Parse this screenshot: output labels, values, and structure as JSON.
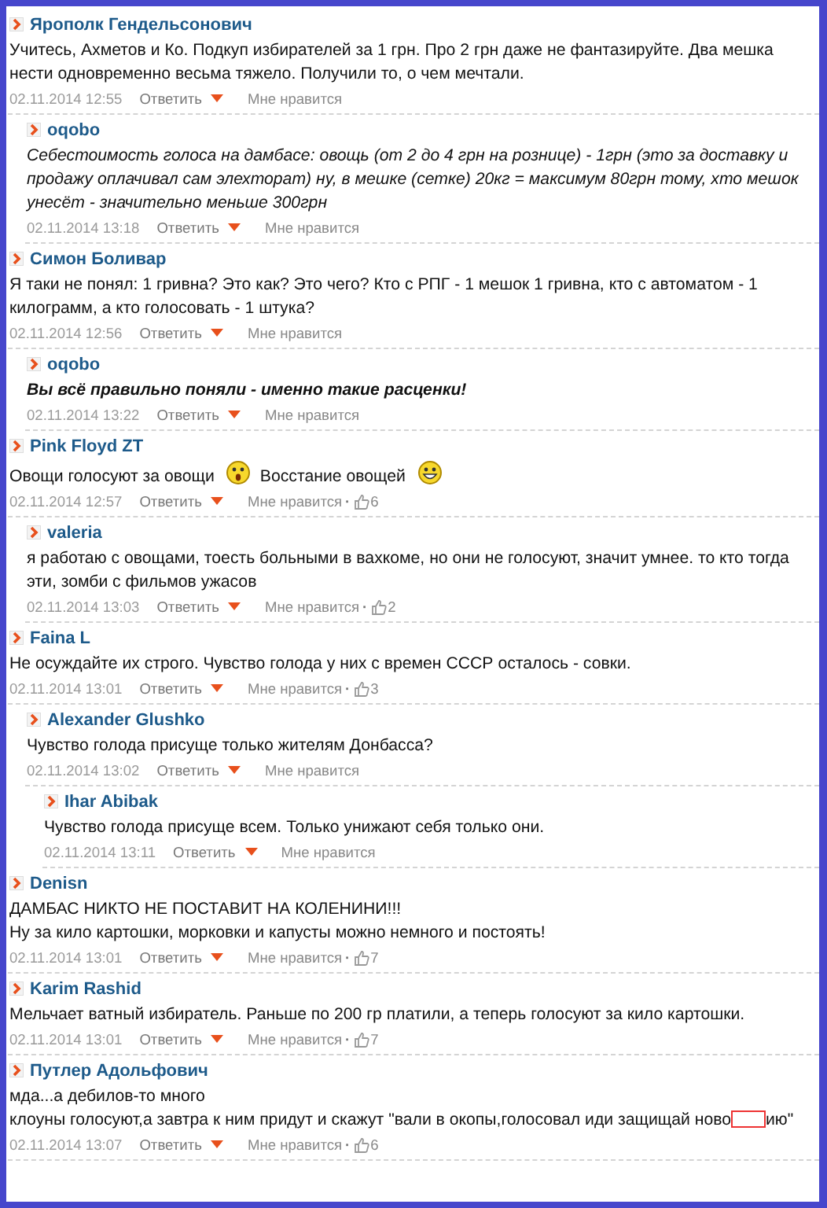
{
  "comments": [
    {
      "author": "Ярополк Гендельсонович",
      "body": [
        {
          "kind": "text",
          "text": "Учитесь, Ахметов и Ко. Подкуп избирателей за 1 грн. Про 2 грн даже не фантазируйте. Два мешка нести одновременно весьма тяжело. Получили то, о чем мечтали."
        }
      ],
      "date": "02.11.2014 12:55",
      "reply": "Ответить",
      "like": "Мне нравится",
      "children": [
        {
          "author": "oqobo",
          "body": [
            {
              "kind": "text",
              "text": "Себестоимость голоса на дамбасе: овощь (от 2 до 4 грн на рознице) - 1грн (это за доставку и продажу оплачивал сам элехторат) ну, в мешке (сетке) 20кг = максимум 80грн тому, хто мешок унесёт - значительно меньше 300грн"
            }
          ],
          "date": "02.11.2014 13:18",
          "reply": "Ответить",
          "like": "Мне нравится"
        }
      ]
    },
    {
      "author": "Симон Боливар",
      "body": [
        {
          "kind": "text",
          "text": "Я таки не понял: 1 гривна? Это как? Это чего? Кто с РПГ - 1 мешок 1 гривна, кто с автоматом - 1 килограмм, а кто голосовать - 1 штука?"
        }
      ],
      "date": "02.11.2014 12:56",
      "reply": "Ответить",
      "like": "Мне нравится",
      "children": [
        {
          "author": "oqobo",
          "body": [
            {
              "kind": "text",
              "text": "Вы всё правильно поняли - именно такие расценки!"
            }
          ],
          "date": "02.11.2014 13:22",
          "reply": "Ответить",
          "like": "Мне нравится"
        }
      ]
    },
    {
      "author": "Pink Floyd ZT",
      "body": [
        {
          "kind": "text",
          "text": "Овощи голосуют за овощи"
        },
        {
          "kind": "surprised-emoji"
        },
        {
          "kind": "text",
          "text": "Восстание овощей"
        },
        {
          "kind": "laughing-emoji"
        }
      ],
      "date": "02.11.2014 12:57",
      "reply": "Ответить",
      "like": "Мне нравится",
      "separator": "·",
      "likes": "6",
      "children": [
        {
          "author": "valeria",
          "body": [
            {
              "kind": "text",
              "text": "я работаю с овощами, тоесть больными в вахкоме, но они не голосуют, значит умнее. то кто тогда эти, зомби с фильмов ужасов"
            }
          ],
          "date": "02.11.2014 13:03",
          "reply": "Ответить",
          "like": "Мне нравится",
          "separator": "·",
          "likes": "2"
        }
      ]
    },
    {
      "author": "Faina L",
      "body": [
        {
          "kind": "text",
          "text": "Не осуждайте их строго. Чувство голода у них с времен СССР осталось - совки."
        }
      ],
      "date": "02.11.2014 13:01",
      "reply": "Ответить",
      "like": "Мне нравится",
      "separator": "·",
      "likes": "3",
      "children": [
        {
          "author": "Alexander Glushko",
          "body": [
            {
              "kind": "text",
              "text": "Чувство голода присуще только жителям Донбасса?"
            }
          ],
          "date": "02.11.2014 13:02",
          "reply": "Ответить",
          "like": "Мне нравится",
          "children": [
            {
              "author": "Ihar Abibak",
              "body": [
                {
                  "kind": "text",
                  "text": "Чувство голода присуще всем. Только унижают себя только они."
                }
              ],
              "date": "02.11.2014 13:11",
              "reply": "Ответить",
              "like": "Мне нравится"
            }
          ]
        }
      ]
    },
    {
      "author": "Denisn",
      "body": [
        {
          "kind": "text",
          "text": "ДАМБАС НИКТО НЕ ПОСТАВИТ НА КОЛЕНИНИ!!!"
        },
        {
          "kind": "break"
        },
        {
          "kind": "text",
          "text": "Ну за кило картошки, морковки и капусты можно немного и постоять!"
        }
      ],
      "date": "02.11.2014 13:01",
      "reply": "Ответить",
      "like": "Мне нравится",
      "separator": "·",
      "likes": "7"
    },
    {
      "author": "Karim Rashid",
      "body": [
        {
          "kind": "text",
          "text": "Мельчает ватный избиратель. Раньше по 200 гр платили, а теперь голосуют за кило картошки."
        }
      ],
      "date": "02.11.2014 13:01",
      "reply": "Ответить",
      "like": "Мне нравится",
      "separator": "·",
      "likes": "7"
    },
    {
      "author": "Путлер Адольфович",
      "body": [
        {
          "kind": "text",
          "text": "мда...а дебилов-то много"
        },
        {
          "kind": "break"
        },
        {
          "kind": "text",
          "text": "клоуны голосуют,а завтра к ним придут и скажут \"вали в окопы,голосовал иди защищай ново"
        },
        {
          "kind": "redacted"
        },
        {
          "kind": "text",
          "text": "ию\""
        }
      ],
      "date": "02.11.2014 13:07",
      "reply": "Ответить",
      "like": "Мне нравится",
      "separator": "·",
      "likes": "6"
    }
  ]
}
